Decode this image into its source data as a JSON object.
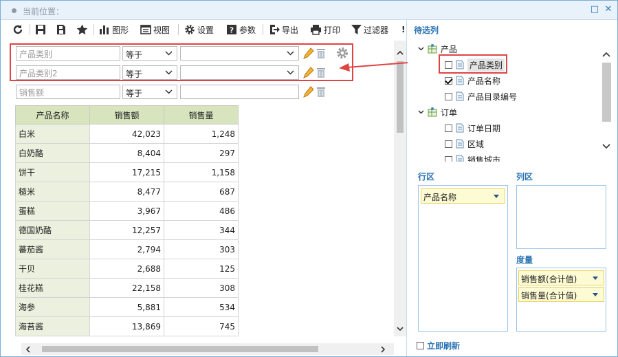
{
  "title": {
    "location_label": "当前位置："
  },
  "toolbar": {
    "chart_label": "图形",
    "view_label": "视图",
    "settings_label": "设置",
    "params_label": "参数",
    "export_label": "导出",
    "print_label": "打印",
    "filter_label": "过滤器",
    "more_label": "!"
  },
  "filters": [
    {
      "field_placeholder": "产品类别",
      "operator": "等于"
    },
    {
      "field_placeholder": "产品类别2",
      "operator": "等于"
    },
    {
      "field_placeholder": "销售额",
      "operator": "等于"
    }
  ],
  "table": {
    "headers": [
      "产品名称",
      "销售额",
      "销售量"
    ],
    "rows": [
      [
        "白米",
        "42,023",
        "1,248"
      ],
      [
        "白奶酪",
        "8,404",
        "297"
      ],
      [
        "饼干",
        "17,215",
        "1,158"
      ],
      [
        "糙米",
        "8,477",
        "687"
      ],
      [
        "蛋糕",
        "3,967",
        "486"
      ],
      [
        "德国奶酪",
        "12,257",
        "344"
      ],
      [
        "蕃茄酱",
        "2,794",
        "303"
      ],
      [
        "干贝",
        "2,688",
        "125"
      ],
      [
        "桂花糕",
        "22,158",
        "308"
      ],
      [
        "海参",
        "5,881",
        "534"
      ],
      [
        "海苔酱",
        "13,869",
        "745"
      ]
    ]
  },
  "right": {
    "pending_title": "待选列",
    "tree": [
      {
        "label": "产品",
        "type": "group"
      },
      {
        "label": "产品类别",
        "checked": false
      },
      {
        "label": "产品名称",
        "checked": true
      },
      {
        "label": "产品目录编号",
        "checked": false
      },
      {
        "label": "订单",
        "type": "group"
      },
      {
        "label": "订单日期",
        "checked": false
      },
      {
        "label": "区域",
        "checked": false
      },
      {
        "label": "销售城市",
        "checked": false
      }
    ],
    "row_zone_title": "行区",
    "col_zone_title": "列区",
    "measure_title": "度量",
    "row_chips": [
      "产品名称"
    ],
    "measure_chips": [
      "销售额(合计值)",
      "销售量(合计值)"
    ],
    "refresh_label": "立即刷新"
  },
  "colors": {
    "accent": "#2a73b5",
    "highlight": "#e04343",
    "header_bg": "#d7e4bd",
    "name_col_bg": "#ebf1de"
  }
}
